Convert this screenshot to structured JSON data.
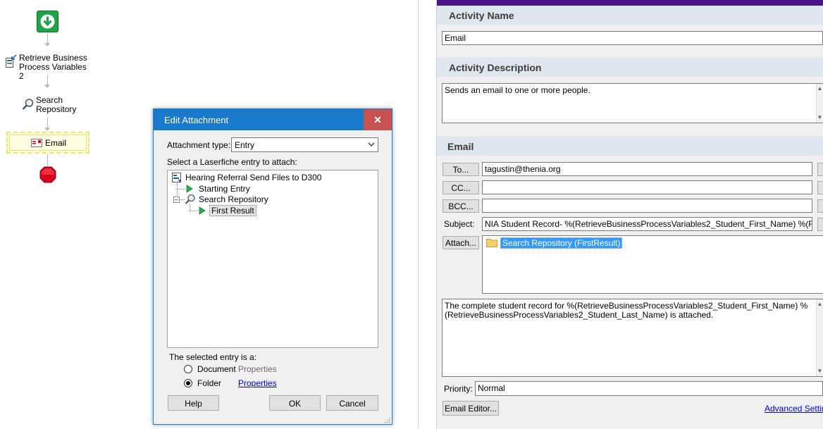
{
  "workflow": {
    "retrieve_label": "Retrieve Business Process Variables 2",
    "search_label": "Search Repository",
    "email_label": "Email"
  },
  "properties": {
    "activity_name_header": "Activity Name",
    "activity_name_value": "Email",
    "activity_description_header": "Activity Description",
    "activity_description_value": "Sends an email to one or more people.",
    "email_header": "Email",
    "to_button": "To...",
    "to_value": "tagustin@thenia.org",
    "cc_button": "CC...",
    "cc_value": "",
    "bcc_button": "BCC...",
    "bcc_value": "",
    "subject_label": "Subject:",
    "subject_value": "NIA Student Record- %(RetrieveBusinessProcessVariables2_Student_First_Name) %(RetrieveBusin",
    "attach_button": "Attach...",
    "attachment_item": "Search Repository (FirstResult)",
    "body_value": "The complete student record for %(RetrieveBusinessProcessVariables2_Student_First_Name) %(RetrieveBusinessProcessVariables2_Student_Last_Name) is attached.",
    "priority_label": "Priority:",
    "priority_value": "Normal",
    "email_editor_button": "Email Editor...",
    "advanced_settings_link": "Advanced Settin"
  },
  "dialog": {
    "title": "Edit Attachment",
    "close_glyph": "✕",
    "attachment_type_label": "Attachment type:",
    "attachment_type_value": "Entry",
    "select_entry_label": "Select a Laserfiche entry to attach:",
    "tree": {
      "root": "Hearing Referral Send Files to D300",
      "starting_entry": "Starting Entry",
      "search_repository": "Search Repository",
      "first_result": "First Result"
    },
    "selected_entry_label": "The selected entry is a:",
    "document_label": "Document",
    "document_properties": "Properties",
    "folder_label": "Folder",
    "folder_properties": "Properties",
    "selected_type": "Folder",
    "help_button": "Help",
    "ok_button": "OK",
    "cancel_button": "Cancel"
  },
  "colors": {
    "start_green": "#1ea346",
    "stop_red": "#d9001b",
    "title_blue": "#1979ca",
    "close_red": "#c75050",
    "panel_accent_purple": "#4b1489",
    "selection_blue": "#3399ff",
    "email_highlight_yellow": "#f2e36a"
  }
}
